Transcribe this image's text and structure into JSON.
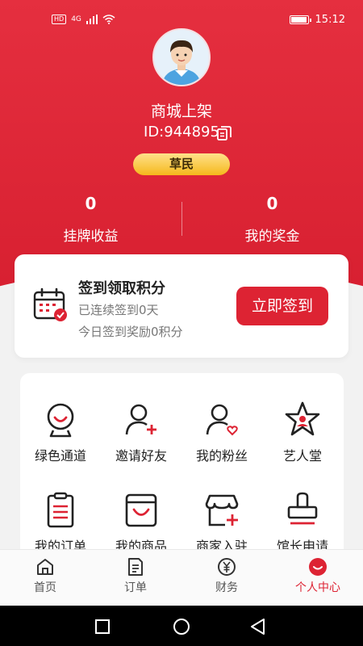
{
  "status_bar": {
    "hd": "HD",
    "network": "4G",
    "time": "15:12"
  },
  "profile": {
    "nickname": "商城上架",
    "id_text": "ID:944895",
    "level": "草民"
  },
  "stats": [
    {
      "value": "0",
      "label": "挂牌收益"
    },
    {
      "value": "0",
      "label": "我的奖金"
    }
  ],
  "checkin": {
    "title": "签到领取积分",
    "line1": "已连续签到0天",
    "line2": "今日签到奖励0积分",
    "button": "立即签到"
  },
  "menu": [
    {
      "label": "绿色通道",
      "icon": "green-channel-icon"
    },
    {
      "label": "邀请好友",
      "icon": "invite-friend-icon"
    },
    {
      "label": "我的粉丝",
      "icon": "fans-icon"
    },
    {
      "label": "艺人堂",
      "icon": "artist-hall-icon"
    },
    {
      "label": "我的订单",
      "icon": "my-orders-icon"
    },
    {
      "label": "我的商品",
      "icon": "my-products-icon"
    },
    {
      "label": "商家入驻",
      "icon": "merchant-join-icon"
    },
    {
      "label": "馆长申请",
      "icon": "curator-apply-icon"
    }
  ],
  "tabs": [
    {
      "label": "首页",
      "icon": "home-icon"
    },
    {
      "label": "订单",
      "icon": "order-icon"
    },
    {
      "label": "财务",
      "icon": "finance-icon"
    },
    {
      "label": "个人中心",
      "icon": "profile-icon",
      "active": true
    }
  ],
  "colors": {
    "brand": "#dd2333",
    "level_gold": "#f5b81c"
  }
}
